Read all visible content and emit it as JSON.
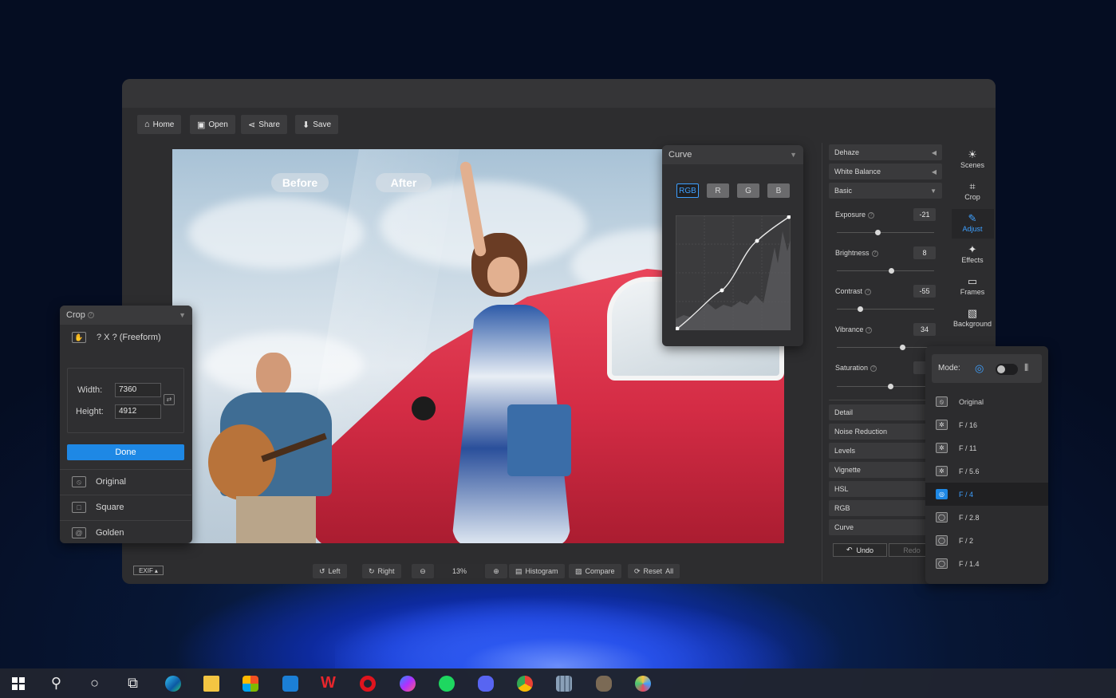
{
  "toolbar": {
    "home": "Home",
    "open": "Open",
    "share": "Share",
    "save": "Save"
  },
  "canvas": {
    "before_label": "Before",
    "after_label": "After"
  },
  "curve_panel": {
    "title": "Curve",
    "channels": [
      "RGB",
      "R",
      "G",
      "B"
    ],
    "active_channel": "RGB"
  },
  "adjust_panel": {
    "sections_top": [
      "Dehaze",
      "White Balance",
      "Basic"
    ],
    "sliders": [
      {
        "name": "Exposure",
        "value": "-21",
        "level": 0.42
      },
      {
        "name": "Brightness",
        "value": "8",
        "level": 0.56
      },
      {
        "name": "Contrast",
        "value": "-55",
        "level": 0.24
      },
      {
        "name": "Vibrance",
        "value": "34",
        "level": 0.67
      },
      {
        "name": "Saturation",
        "value": "",
        "level": 0.55
      }
    ],
    "sections_bottom": [
      "Detail",
      "Noise Reduction",
      "Levels",
      "Vignette",
      "HSL",
      "RGB",
      "Curve"
    ],
    "undo": "Undo",
    "redo": "Redo"
  },
  "tools": [
    {
      "label": "Scenes",
      "icon": "sun-icon"
    },
    {
      "label": "Crop",
      "icon": "crop-icon"
    },
    {
      "label": "Adjust",
      "icon": "pencil-icon",
      "active": true
    },
    {
      "label": "Effects",
      "icon": "sparkle-icon"
    },
    {
      "label": "Frames",
      "icon": "frame-icon"
    },
    {
      "label": "Background",
      "icon": "background-icon"
    }
  ],
  "crop_panel": {
    "title": "Crop",
    "ratio": "? X ? (Freeform)",
    "width_label": "Width:",
    "height_label": "Height:",
    "width": "7360",
    "height": "4912",
    "done": "Done",
    "presets": [
      "Original",
      "Square",
      "Golden"
    ]
  },
  "aperture_panel": {
    "mode_label": "Mode:",
    "items": [
      "Original",
      "F / 16",
      "F / 11",
      "F / 5.6",
      "F / 4",
      "F / 2.8",
      "F / 2",
      "F / 1.4"
    ],
    "selected": "F / 4"
  },
  "bottom_bar": {
    "exif": "EXIF",
    "left": "Left",
    "right": "Right",
    "zoom": "13%",
    "histogram": "Histogram",
    "compare": "Compare",
    "reset": "Reset",
    "reset_all": "All"
  },
  "colors": {
    "accent": "#1e88e5",
    "app_bg": "#2d2d2f",
    "car_red": "#d42c45"
  }
}
